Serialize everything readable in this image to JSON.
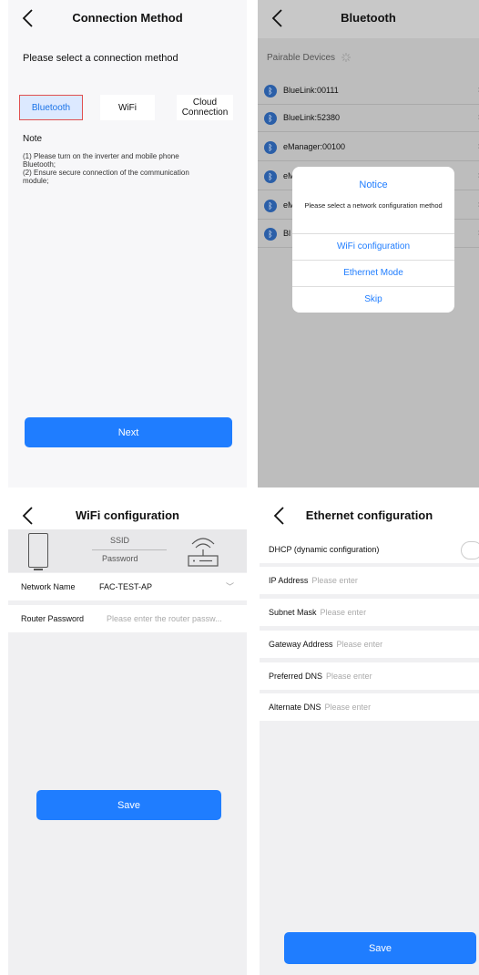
{
  "conn": {
    "title": "Connection Method",
    "prompt": "Please select a connection method",
    "methods": [
      "Bluetooth",
      "WiFi",
      "Cloud Connection"
    ],
    "note_title": "Note",
    "note_lines": [
      "(1) Please turn on the inverter and mobile phone Bluetooth;",
      "(2) Ensure secure connection of the communication module;"
    ],
    "next": "Next"
  },
  "bt": {
    "title": "Bluetooth",
    "section": "Pairable Devices",
    "devices": [
      "BlueLink:00111",
      "BlueLink:52380",
      "eManager:00100",
      "eM",
      "eM",
      "Bl"
    ],
    "modal": {
      "title": "Notice",
      "message": "Please select a network configuration method",
      "options": [
        "WiFi configuration",
        "Ethernet Mode",
        "Skip"
      ]
    }
  },
  "wifi": {
    "title": "WiFi configuration",
    "ssid_label": "SSID",
    "password_label": "Password",
    "network_name_label": "Network Name",
    "network_name_value": "FAC-TEST-AP",
    "router_password_label": "Router Password",
    "router_password_placeholder": "Please enter the router passw...",
    "save": "Save"
  },
  "eth": {
    "title": "Ethernet configuration",
    "dhcp_label": "DHCP (dynamic configuration)",
    "fields": [
      {
        "label": "IP Address",
        "placeholder": "Please enter"
      },
      {
        "label": "Subnet Mask",
        "placeholder": "Please enter"
      },
      {
        "label": "Gateway Address",
        "placeholder": "Please enter"
      },
      {
        "label": "Preferred DNS",
        "placeholder": "Please enter"
      },
      {
        "label": "Alternate DNS",
        "placeholder": "Please enter"
      }
    ],
    "save": "Save"
  },
  "colors": {
    "accent": "#1f7dff",
    "selected_border": "#e05050"
  }
}
